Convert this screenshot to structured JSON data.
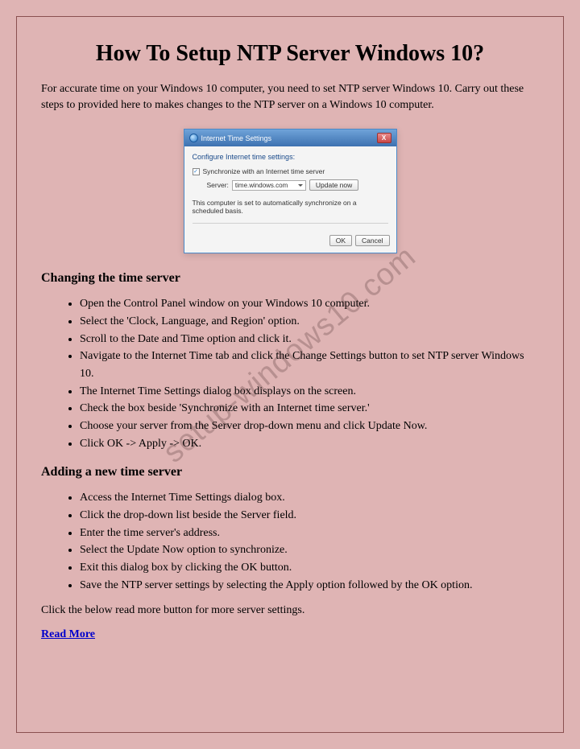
{
  "title": "How To Setup NTP Server Windows 10?",
  "intro": "For accurate time on your Windows 10 computer, you need to set NTP server Windows 10. Carry out these steps to provided here to makes changes to the NTP server on a Windows 10 computer.",
  "watermark": "setup-windows10.com",
  "dialog": {
    "title": "Internet Time Settings",
    "close": "X",
    "body_title": "Configure Internet time settings:",
    "check_mark": "✓",
    "sync_label": "Synchronize with an Internet time server",
    "server_label": "Server:",
    "server_value": "time.windows.com",
    "update_btn": "Update now",
    "status": "This computer is set to automatically synchronize on a scheduled basis.",
    "ok_btn": "OK",
    "cancel_btn": "Cancel"
  },
  "section1": {
    "heading": "Changing the time server",
    "items": [
      "Open the Control Panel window on your Windows 10 computer.",
      "Select the 'Clock, Language, and Region' option.",
      "Scroll to the Date and Time option and click it.",
      "Navigate to the Internet Time tab and click the Change Settings button to set NTP server Windows 10.",
      "The Internet Time Settings dialog box displays on the screen.",
      "Check the box beside 'Synchronize with an Internet time server.'",
      "Choose your server from the Server drop-down menu and click Update Now.",
      "Click OK -> Apply -> OK."
    ]
  },
  "section2": {
    "heading": "Adding a new time server",
    "items": [
      "Access the Internet Time Settings dialog box.",
      "Click the drop-down list beside the Server field.",
      "Enter the time server's address.",
      "Select the Update Now option to synchronize.",
      "Exit this dialog box by clicking the OK button.",
      "Save the NTP server settings by selecting the Apply option followed by the OK option."
    ]
  },
  "closing": "Click the below read more button for more server settings.",
  "read_more": "Read More"
}
